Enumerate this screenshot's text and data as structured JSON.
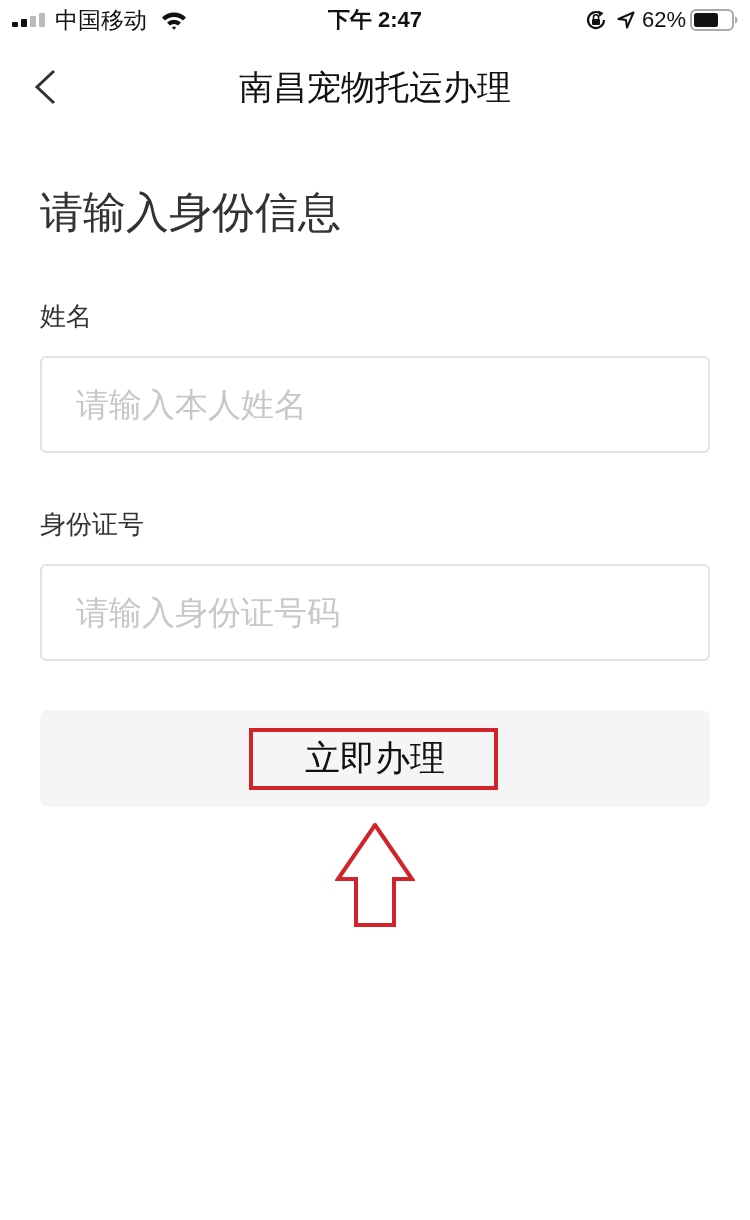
{
  "status_bar": {
    "carrier": "中国移动",
    "time": "下午 2:47",
    "battery": "62%"
  },
  "nav": {
    "title": "南昌宠物托运办理"
  },
  "form": {
    "heading": "请输入身份信息",
    "fields": [
      {
        "label": "姓名",
        "placeholder": "请输入本人姓名"
      },
      {
        "label": "身份证号",
        "placeholder": "请输入身份证号码"
      }
    ],
    "submit": {
      "label": "立即办理",
      "highlighted": true,
      "arrow_pointing": true
    }
  }
}
